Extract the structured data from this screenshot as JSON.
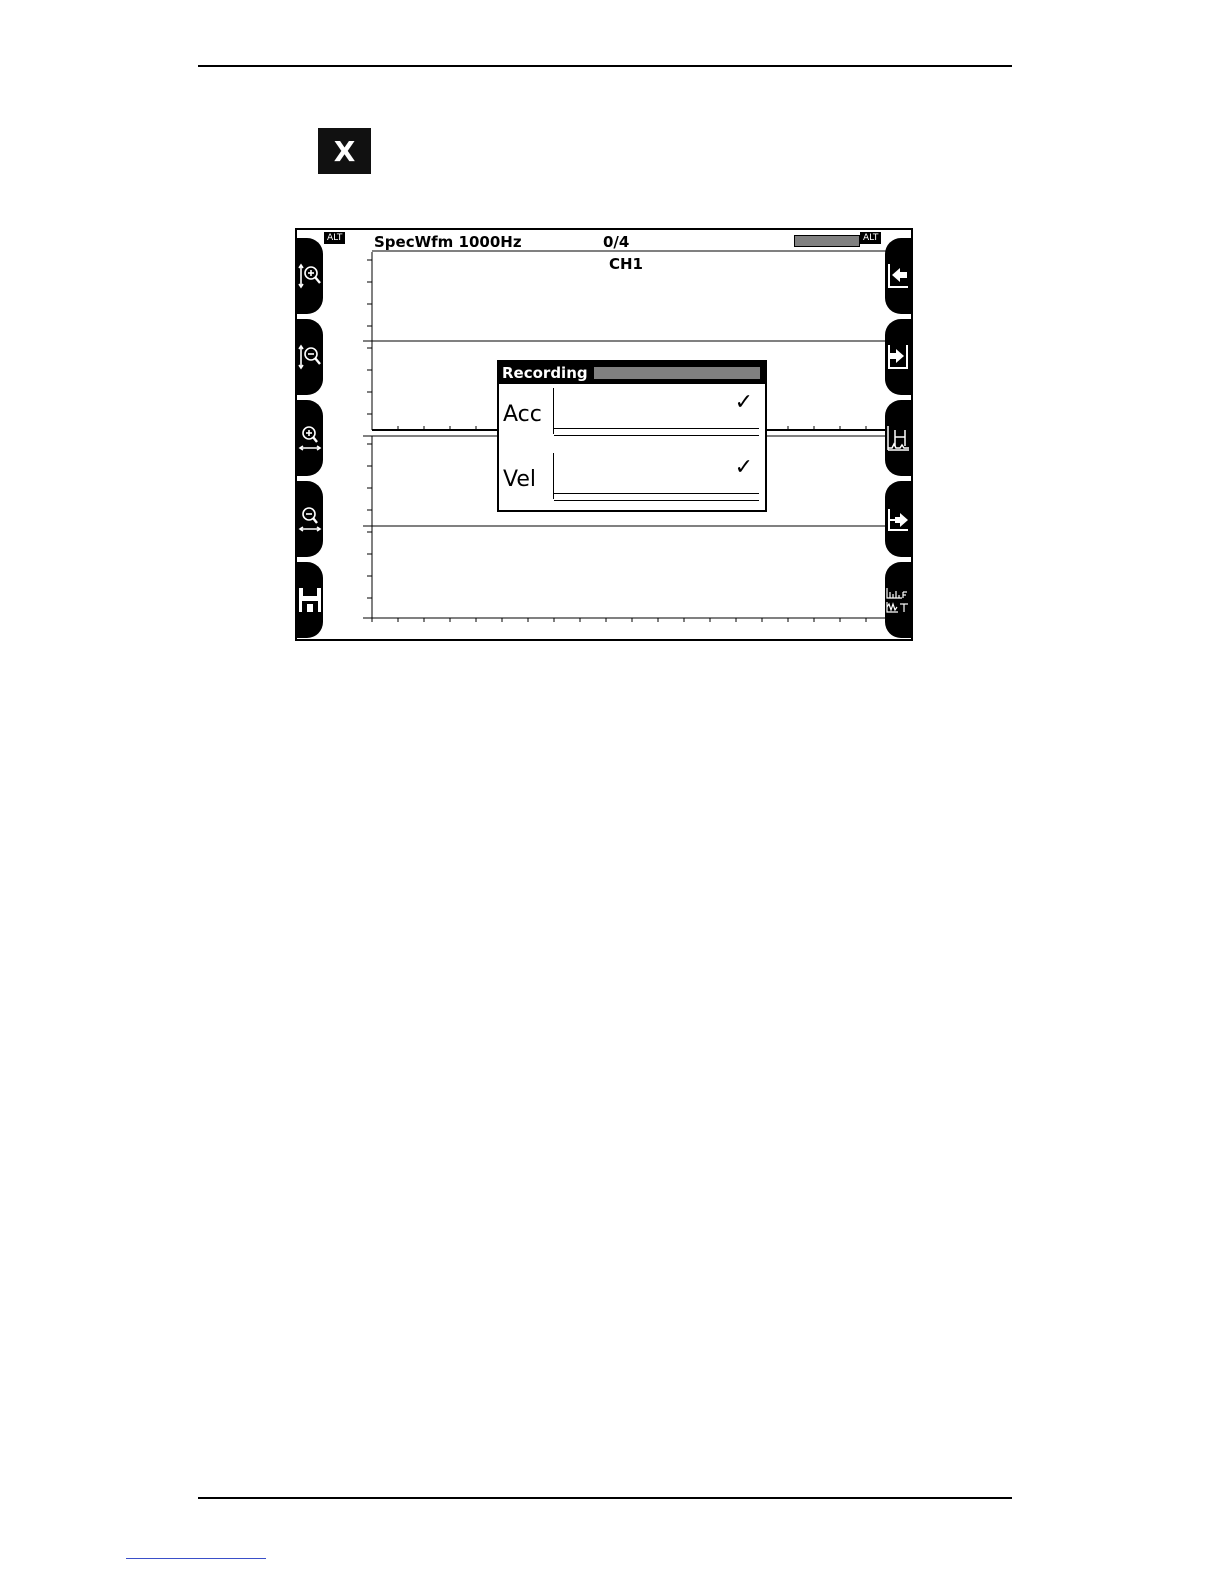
{
  "key_label": "X",
  "screen": {
    "alt_left": "ALT",
    "alt_right": "ALT",
    "title": "SpecWfm 1000Hz",
    "record_counter": "0/4",
    "channel": "CH1"
  },
  "dialog": {
    "title": "Recording",
    "rows": [
      {
        "label": "Acc",
        "check": "✓"
      },
      {
        "label": "Vel",
        "check": "✓"
      }
    ]
  },
  "softkeys": {
    "left": [
      "vertical-zoom-in-icon",
      "vertical-zoom-out-icon",
      "horizontal-zoom-in-icon",
      "horizontal-zoom-out-icon",
      "save-icon"
    ],
    "right": [
      "move-left-to-start-icon",
      "move-right-icon",
      "harmonic-cursor-icon",
      "export-icon",
      "spectrum-waveform-toggle-icon"
    ]
  }
}
